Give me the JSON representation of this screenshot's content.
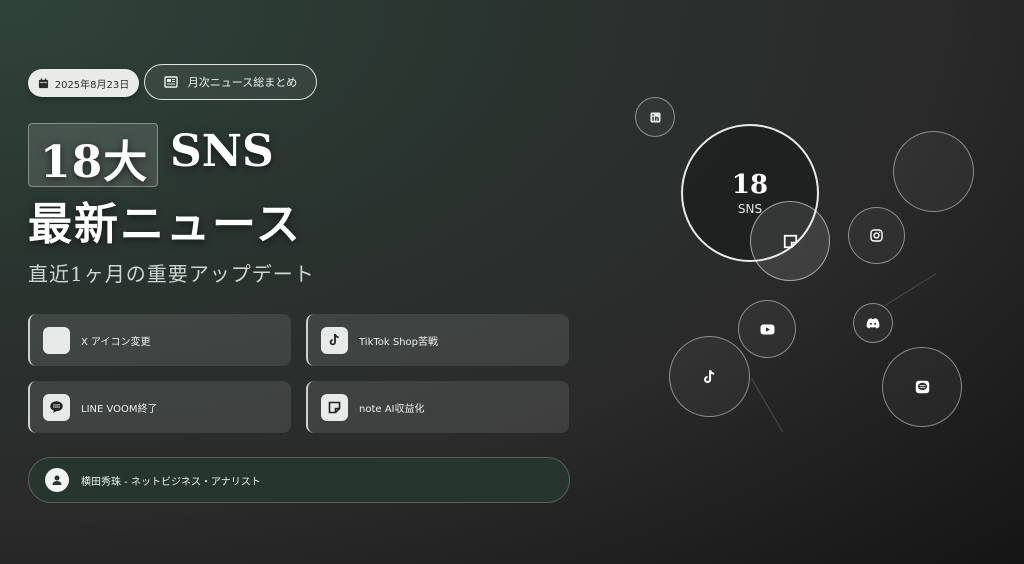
{
  "header": {
    "date": "2025年8月23日",
    "news_label": "月次ニュース総まとめ"
  },
  "headline": {
    "number": "18大",
    "sns": "SNS",
    "line2": "最新ニュース",
    "subtitle": "直近1ヶ月の重要アップデート"
  },
  "cards": [
    {
      "label": "X アイコン変更",
      "icon": "x-icon"
    },
    {
      "label": "TikTok Shop苦戦",
      "icon": "tiktok-icon"
    },
    {
      "label": "LINE VOOM終了",
      "icon": "line-icon"
    },
    {
      "label": "note AI収益化",
      "icon": "note-icon"
    }
  ],
  "author": {
    "text": "横田秀珠 - ネットビジネス・アナリスト",
    "icon": "user-icon"
  },
  "bubble_main": {
    "number": "18",
    "label": "SNS"
  },
  "bubble_icons": [
    "linkedin-icon",
    "note-icon",
    "instagram-icon",
    "youtube-icon",
    "discord-icon",
    "tiktok-icon",
    "line-icon"
  ]
}
